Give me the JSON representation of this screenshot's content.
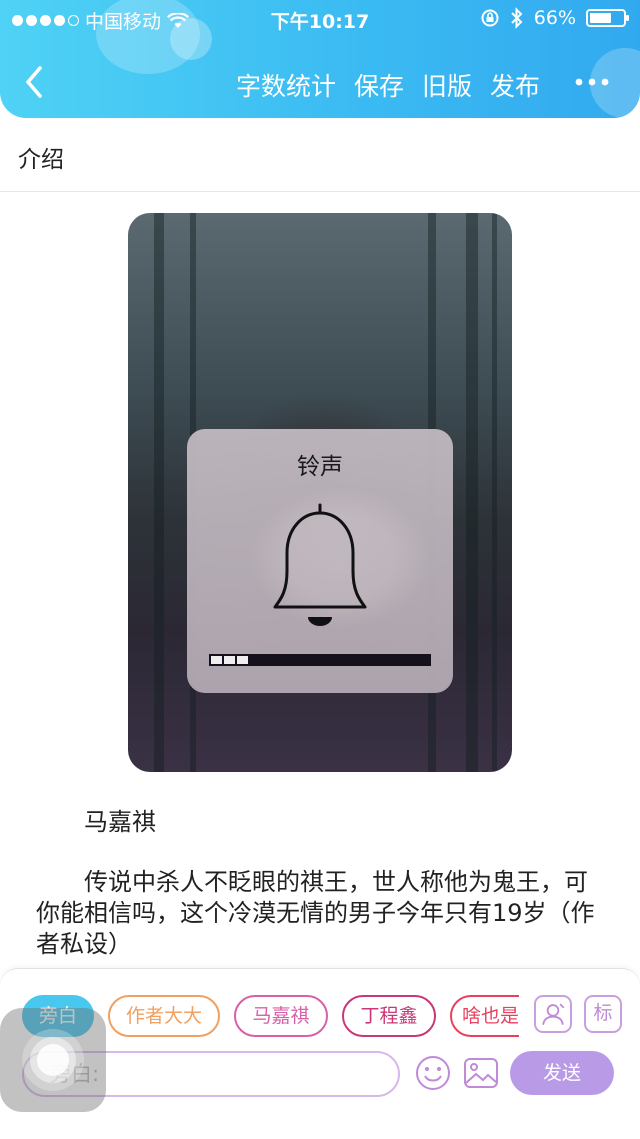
{
  "status_bar": {
    "carrier": "中国移动",
    "time": "下午10:17",
    "battery_percent": "66%",
    "battery_level": 0.66
  },
  "nav": {
    "back_icon": "chevron-left-icon",
    "actions": [
      "字数统计",
      "保存",
      "旧版",
      "发布"
    ],
    "more_icon": "more-dots-icon"
  },
  "intro": {
    "label": "介绍"
  },
  "hud": {
    "title": "铃声",
    "icon": "bell-icon",
    "level_blocks": 3
  },
  "content": {
    "character_name": "马嘉祺",
    "story": "传说中杀人不眨眼的祺王，世人称他为鬼王，可你能相信吗，这个冷漠无情的男子今年只有19岁（作者私设）"
  },
  "composer": {
    "tags": [
      {
        "label": "旁白",
        "color": "#48c8ee",
        "active": true
      },
      {
        "label": "作者大大",
        "color": "#f0a060",
        "active": false
      },
      {
        "label": "马嘉祺",
        "color": "#d860a8",
        "active": false
      },
      {
        "label": "丁程鑫",
        "color": "#c83878",
        "active": false
      },
      {
        "label": "啥也是",
        "color": "#e84060",
        "active": false
      }
    ],
    "role_icon": "person-card-icon",
    "mark_label": "标",
    "input_placeholder": "旁白:",
    "emoji_icon": "smile-icon",
    "image_icon": "image-icon",
    "send_label": "发送"
  },
  "colors": {
    "header_gradient_start": "#4fd2f5",
    "header_gradient_end": "#32a9ef",
    "accent_purple": "#b99ae6"
  }
}
